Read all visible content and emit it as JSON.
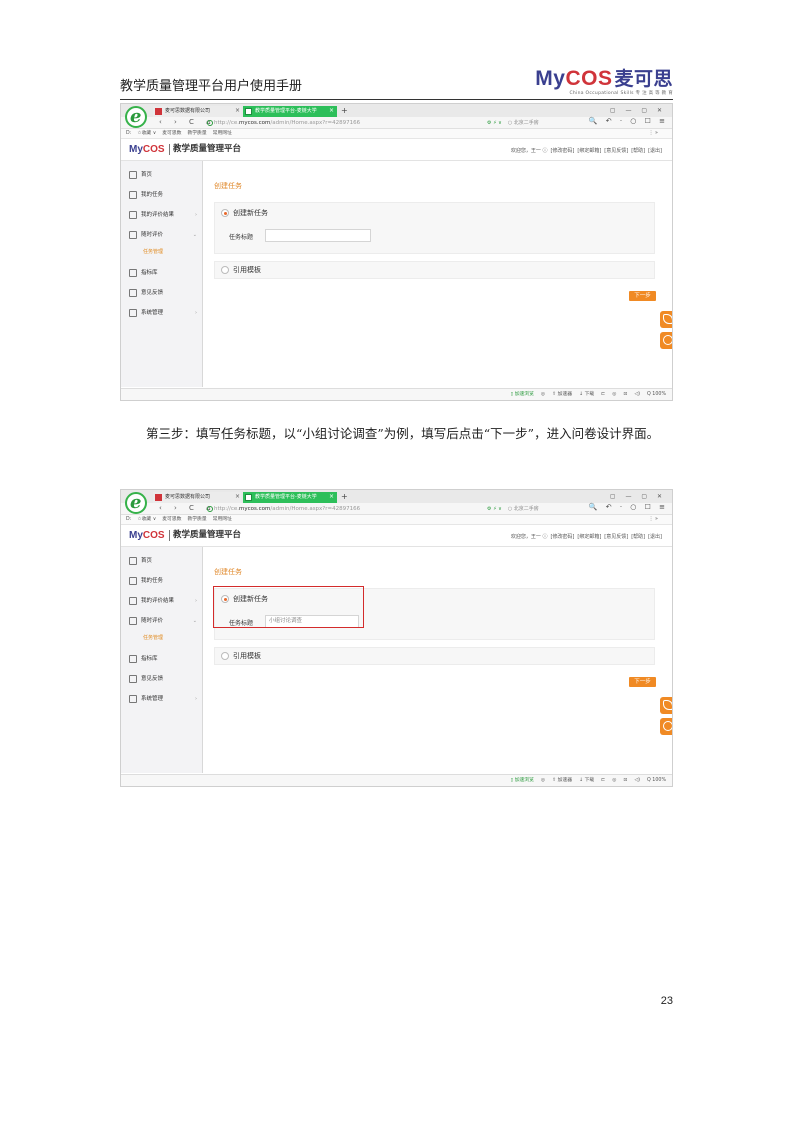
{
  "header": {
    "doc_title": "教学质量管理平台用户使用手册",
    "logo_text_1": "My",
    "logo_text_2": "COS",
    "logo_cn": "麦可思",
    "logo_tagline": "China Occupational Skills  专 注 高 等 教 育"
  },
  "browser": {
    "tab1_title": "麦可思数据有限公司",
    "tab2_title": "教学质量管理平台-麦链大学",
    "tab_close": "×",
    "new_tab": "+",
    "window_controls": "▢ — ▢ ✕",
    "nav_buttons": "‹ › C ⌂",
    "url_prefix": "http://ce.",
    "url_domain": "mycos.com",
    "url_path": "/admin/Home.aspx?r=42897166",
    "search_engine": "⚙ ⚡ ∨",
    "search_placeholder": "○ 北京二手房",
    "right_tools": "🔍 ↶ · ○ ☐ ≡",
    "bookmarks": [
      "D:",
      "☆收藏 ∨",
      "麦可思数",
      "教学质量",
      "常用网址"
    ],
    "bookmarks_right": "⋮ »"
  },
  "app": {
    "logo_1": "My",
    "logo_2": "COS",
    "name": "教学质量管理平台",
    "user_links": [
      "欢迎您，王一 ⓘ",
      "[修改密码]",
      "[绑定邮箱]",
      "[意见反馈]",
      "[帮助]",
      "[退出]"
    ],
    "sidebar": [
      {
        "label": "首页",
        "icon": "home-icon"
      },
      {
        "label": "我的任务",
        "icon": "user-icon"
      },
      {
        "label": "我的评价结果",
        "icon": "list-icon",
        "arrow": "›"
      },
      {
        "label": "随时评价",
        "icon": "document-icon",
        "arrow": "⌄"
      },
      {
        "label": "指标库",
        "icon": "bar-chart-icon"
      },
      {
        "label": "意见反馈",
        "icon": "mail-icon"
      },
      {
        "label": "系统管理",
        "icon": "gear-icon",
        "arrow": "›"
      }
    ],
    "sidebar_subitem": "任务管理",
    "section_title": "创建任务",
    "option_new": "创建新任务",
    "field_label": "任务标题",
    "option_template": "引用模板",
    "next_button": "下一步",
    "statusbar": [
      "▯ 加速浏览",
      "◎",
      "⇪ 加速器",
      "↓ 下载",
      "⊏",
      "◎",
      "⊡",
      "◁)",
      "Q 100%"
    ]
  },
  "screenshots": [
    {
      "input_value": ""
    },
    {
      "input_value": "小组讨论调查"
    }
  ],
  "body_text": "第三步：填写任务标题，以“小组讨论调查”为例，填写后点击“下一步”，进入问卷设计界面。",
  "page_number": "23",
  "colors": {
    "accent": "#f08a24",
    "brand_blue": "#3a3f8f",
    "brand_red": "#d0343a",
    "highlight": "#d32b2b",
    "browser_green": "#2dbf5a"
  }
}
